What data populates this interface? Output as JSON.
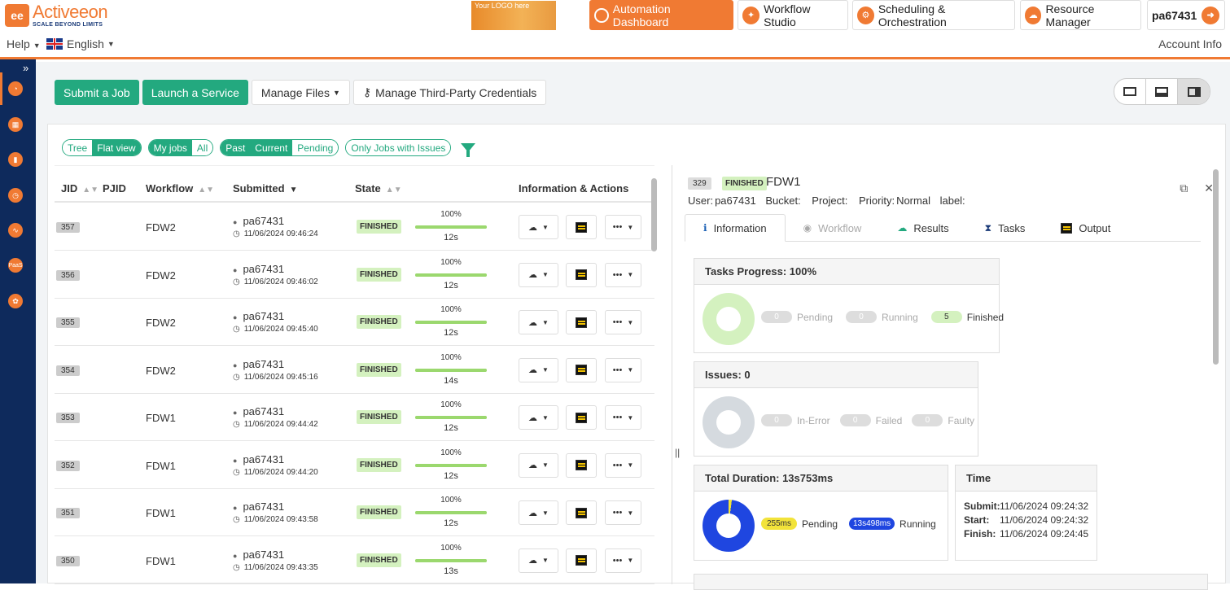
{
  "header": {
    "logo_name": "Activeeon",
    "logo_tagline": "SCALE BEYOND LIMITS",
    "your_logo": "Your LOGO here",
    "nav": {
      "automation": "Automation Dashboard",
      "studio": "Workflow Studio",
      "scheduling": "Scheduling & Orchestration",
      "resource": "Resource Manager",
      "user": "pa67431"
    },
    "help": "Help",
    "language": "English",
    "account_info": "Account Info"
  },
  "toolbar": {
    "submit_job": "Submit a Job",
    "launch_service": "Launch a Service",
    "manage_files": "Manage Files",
    "credentials": "Manage Third-Party Credentials"
  },
  "filters": {
    "tree": "Tree",
    "flat_view": "Flat view",
    "my_jobs": "My jobs",
    "all": "All",
    "past": "Past",
    "current": "Current",
    "pending": "Pending",
    "issues": "Only Jobs with Issues"
  },
  "table": {
    "columns": {
      "jid": "JID",
      "pjid": "PJID",
      "workflow": "Workflow",
      "submitted": "Submitted",
      "state": "State",
      "info": "Information & Actions"
    },
    "rows": [
      {
        "jid": "357",
        "workflow": "FDW2",
        "user": "pa67431",
        "date": "11/06/2024 09:46:24",
        "state": "FINISHED",
        "progress": "100%",
        "duration": "12s"
      },
      {
        "jid": "356",
        "workflow": "FDW2",
        "user": "pa67431",
        "date": "11/06/2024 09:46:02",
        "state": "FINISHED",
        "progress": "100%",
        "duration": "12s"
      },
      {
        "jid": "355",
        "workflow": "FDW2",
        "user": "pa67431",
        "date": "11/06/2024 09:45:40",
        "state": "FINISHED",
        "progress": "100%",
        "duration": "12s"
      },
      {
        "jid": "354",
        "workflow": "FDW2",
        "user": "pa67431",
        "date": "11/06/2024 09:45:16",
        "state": "FINISHED",
        "progress": "100%",
        "duration": "14s"
      },
      {
        "jid": "353",
        "workflow": "FDW1",
        "user": "pa67431",
        "date": "11/06/2024 09:44:42",
        "state": "FINISHED",
        "progress": "100%",
        "duration": "12s"
      },
      {
        "jid": "352",
        "workflow": "FDW1",
        "user": "pa67431",
        "date": "11/06/2024 09:44:20",
        "state": "FINISHED",
        "progress": "100%",
        "duration": "12s"
      },
      {
        "jid": "351",
        "workflow": "FDW1",
        "user": "pa67431",
        "date": "11/06/2024 09:43:58",
        "state": "FINISHED",
        "progress": "100%",
        "duration": "12s"
      },
      {
        "jid": "350",
        "workflow": "FDW1",
        "user": "pa67431",
        "date": "11/06/2024 09:43:35",
        "state": "FINISHED",
        "progress": "100%",
        "duration": "13s"
      }
    ]
  },
  "detail": {
    "jid": "329",
    "state": "FINISHED",
    "name": "FDW1",
    "user_label": "User:",
    "user": "pa67431",
    "bucket_label": "Bucket:",
    "project_label": "Project:",
    "priority_label": "Priority:",
    "priority": "Normal",
    "label_label": "label:",
    "tabs": {
      "information": "Information",
      "workflow": "Workflow",
      "results": "Results",
      "tasks": "Tasks",
      "output": "Output"
    },
    "progress_title": "Tasks Progress: 100%",
    "pending_count": "0",
    "pending_label": "Pending",
    "running_count": "0",
    "running_label": "Running",
    "finished_count": "5",
    "finished_label": "Finished",
    "issues_title": "Issues: 0",
    "inerror_count": "0",
    "inerror_label": "In-Error",
    "failed_count": "0",
    "failed_label": "Failed",
    "faulty_count": "0",
    "faulty_label": "Faulty",
    "duration_title": "Total Duration: 13s753ms",
    "dur_pending": "255ms",
    "dur_pending_label": "Pending",
    "dur_running": "13s498ms",
    "dur_running_label": "Running",
    "time_title": "Time",
    "submit_label": "Submit:",
    "submit": "11/06/2024 09:24:32",
    "start_label": "Start:",
    "start": "11/06/2024 09:24:32",
    "finish_label": "Finish:",
    "finish": "11/06/2024 09:24:45"
  },
  "colors": {
    "accent": "#f07a33",
    "green": "#23a97f",
    "sidebar": "#0e2a5c",
    "running": "#1f46e0",
    "pending": "#f2e33a"
  }
}
